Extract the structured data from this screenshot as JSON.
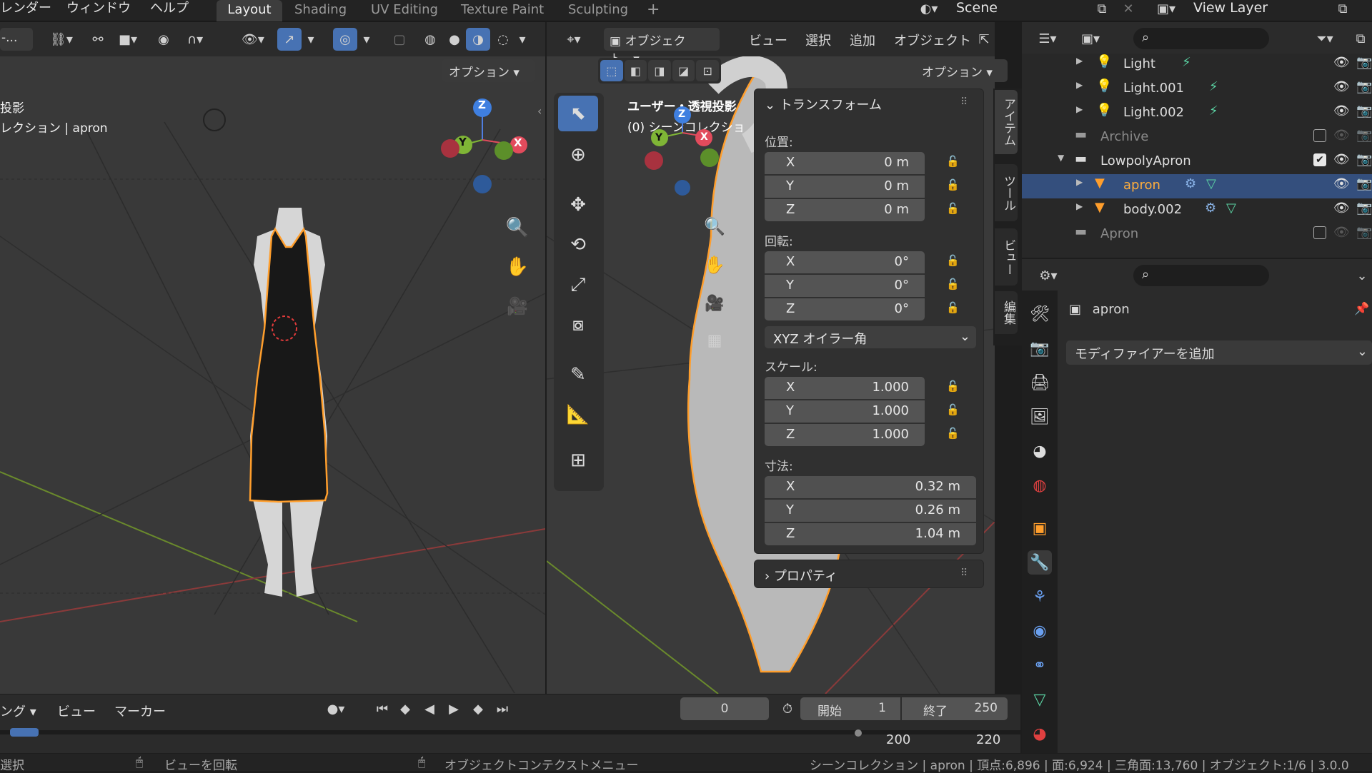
{
  "topbar": {
    "menus": [
      "レンダー",
      "ウィンドウ",
      "ヘルプ"
    ],
    "workspaces": [
      "Layout",
      "Shading",
      "UV Editing",
      "Texture Paint",
      "Sculpting"
    ],
    "add_tab": "+",
    "scene": "Scene",
    "view_layer": "View Layer"
  },
  "left_viewport": {
    "header_dropdown": "-...",
    "options_label": "オプション",
    "overlay_text_1": "投影",
    "overlay_text_2": "レクション | apron",
    "gizmo": {
      "x": "X",
      "y": "Y",
      "z": "Z"
    }
  },
  "right_viewport": {
    "mode": "オブジェクト...",
    "menus": [
      "ビュー",
      "選択",
      "追加",
      "オブジェクト"
    ],
    "options_label": "オプション",
    "overlay_text_1": "ユーザー・透視投影",
    "overlay_text_2": "(0) シーンコレクショ",
    "gizmo": {
      "x": "X",
      "y": "Y",
      "z": "Z"
    },
    "side_tabs": [
      "アイテム",
      "ツール",
      "ビュー",
      "編集"
    ]
  },
  "transform_panel": {
    "title": "トランスフォーム",
    "location_label": "位置:",
    "location": [
      {
        "axis": "X",
        "value": "0 m"
      },
      {
        "axis": "Y",
        "value": "0 m"
      },
      {
        "axis": "Z",
        "value": "0 m"
      }
    ],
    "rotation_label": "回転:",
    "rotation": [
      {
        "axis": "X",
        "value": "0°"
      },
      {
        "axis": "Y",
        "value": "0°"
      },
      {
        "axis": "Z",
        "value": "0°"
      }
    ],
    "rotation_mode": "XYZ オイラー角",
    "scale_label": "スケール:",
    "scale": [
      {
        "axis": "X",
        "value": "1.000"
      },
      {
        "axis": "Y",
        "value": "1.000"
      },
      {
        "axis": "Z",
        "value": "1.000"
      }
    ],
    "dimensions_label": "寸法:",
    "dimensions": [
      {
        "axis": "X",
        "value": "0.32 m"
      },
      {
        "axis": "Y",
        "value": "0.26 m"
      },
      {
        "axis": "Z",
        "value": "1.04 m"
      }
    ],
    "properties_label": "プロパティ"
  },
  "outliner": {
    "rows": [
      {
        "name": "Light",
        "type": "light"
      },
      {
        "name": "Light.001",
        "type": "light"
      },
      {
        "name": "Light.002",
        "type": "light"
      },
      {
        "name": "Archive",
        "type": "collection"
      },
      {
        "name": "LowpolyApron",
        "type": "collection"
      },
      {
        "name": "apron",
        "type": "mesh"
      },
      {
        "name": "body.002",
        "type": "mesh"
      },
      {
        "name": "Apron",
        "type": "collection"
      }
    ]
  },
  "properties": {
    "object_name": "apron",
    "add_modifier": "モディファイアーを追加"
  },
  "timeline": {
    "left_menu": "ング",
    "menus": [
      "ビュー",
      "マーカー"
    ],
    "current_frame": "0",
    "start_label": "開始",
    "start_value": "1",
    "end_label": "終了",
    "end_value": "250",
    "ruler": [
      "200",
      "220"
    ]
  },
  "statusbar": {
    "left": "選択",
    "middle": "ビューを回転",
    "right_hint": "オブジェクトコンテクストメニュー",
    "stats": "シーンコレクション | apron | 頂点:6,896 | 面:6,924 | 三角面:13,760 | オブジェクト:1/6 | 3.0.0"
  },
  "colors": {
    "accent": "#4772b3",
    "selection": "#ff9e2c",
    "bg": "#1d1d1d"
  }
}
